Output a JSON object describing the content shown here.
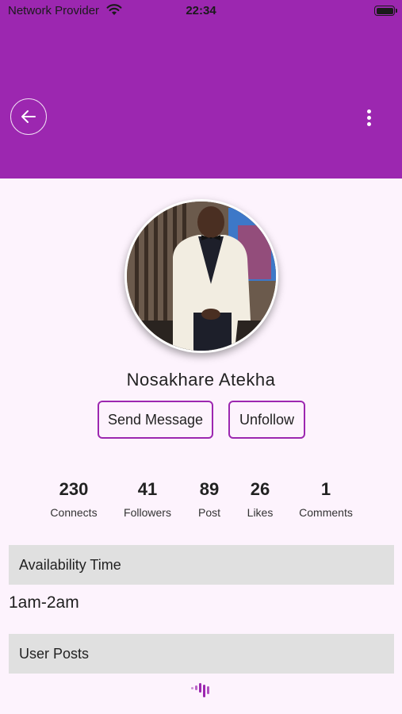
{
  "status_bar": {
    "carrier": "Network Provider",
    "time": "22:34",
    "wifi_icon": "wifi-icon",
    "battery_icon": "battery-full-icon"
  },
  "app_bar": {
    "color": "#9c27b0",
    "back_icon": "arrow-left-icon",
    "menu_icon": "more-vertical-icon"
  },
  "profile": {
    "name": "Nosakhare Atekha",
    "avatar": "profile-photo",
    "send_message_label": "Send Message",
    "unfollow_label": "Unfollow"
  },
  "stats": [
    {
      "value": "230",
      "label": "Connects"
    },
    {
      "value": "41",
      "label": "Followers"
    },
    {
      "value": "89",
      "label": "Post"
    },
    {
      "value": "26",
      "label": "Likes"
    },
    {
      "value": "1",
      "label": "Comments"
    }
  ],
  "availability": {
    "header": "Availability Time",
    "value": "1am-2am"
  },
  "posts": {
    "header": "User Posts",
    "loading_icon": "loading-icon"
  }
}
